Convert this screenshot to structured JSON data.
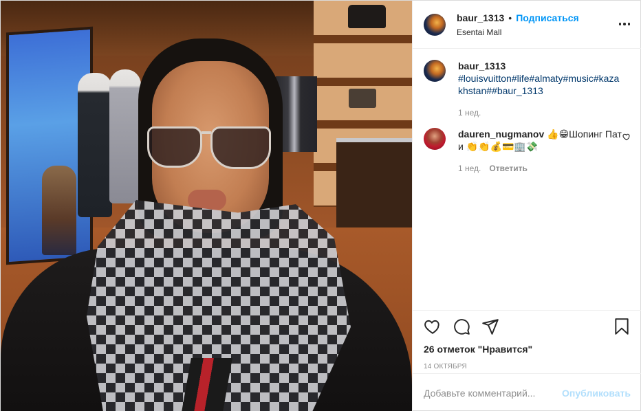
{
  "post": {
    "author": {
      "username": "baur_1313",
      "follow_label": "Подписаться",
      "separator": "•",
      "location": "Esentai Mall",
      "avatar_icon": "avatar-photo"
    },
    "caption": {
      "username": "baur_1313",
      "text": "#louisvuitton#life#almaty#music#kazakhstan##baur_1313",
      "time": "1 нед."
    },
    "comments": [
      {
        "username": "dauren_nugmanov",
        "text": "👍😁Шопинг Пати 👏👏💰💳🏢💸",
        "time": "1 нед.",
        "reply_label": "Ответить",
        "like_icon": "heart-outline-icon"
      }
    ],
    "likes_text": "26 отметок \"Нравится\"",
    "date_text": "14 октября",
    "add_comment": {
      "placeholder": "Добавьте комментарий...",
      "publish_label": "Опубликовать"
    },
    "icons": [
      "more-options-icon",
      "heart-icon",
      "comment-icon",
      "share-icon",
      "bookmark-icon"
    ],
    "colors": {
      "link": "#0095f6",
      "hashtag": "#00376b",
      "muted": "#8e8e8e",
      "publish_disabled": "#b2dffc",
      "border": "#efefef"
    }
  }
}
